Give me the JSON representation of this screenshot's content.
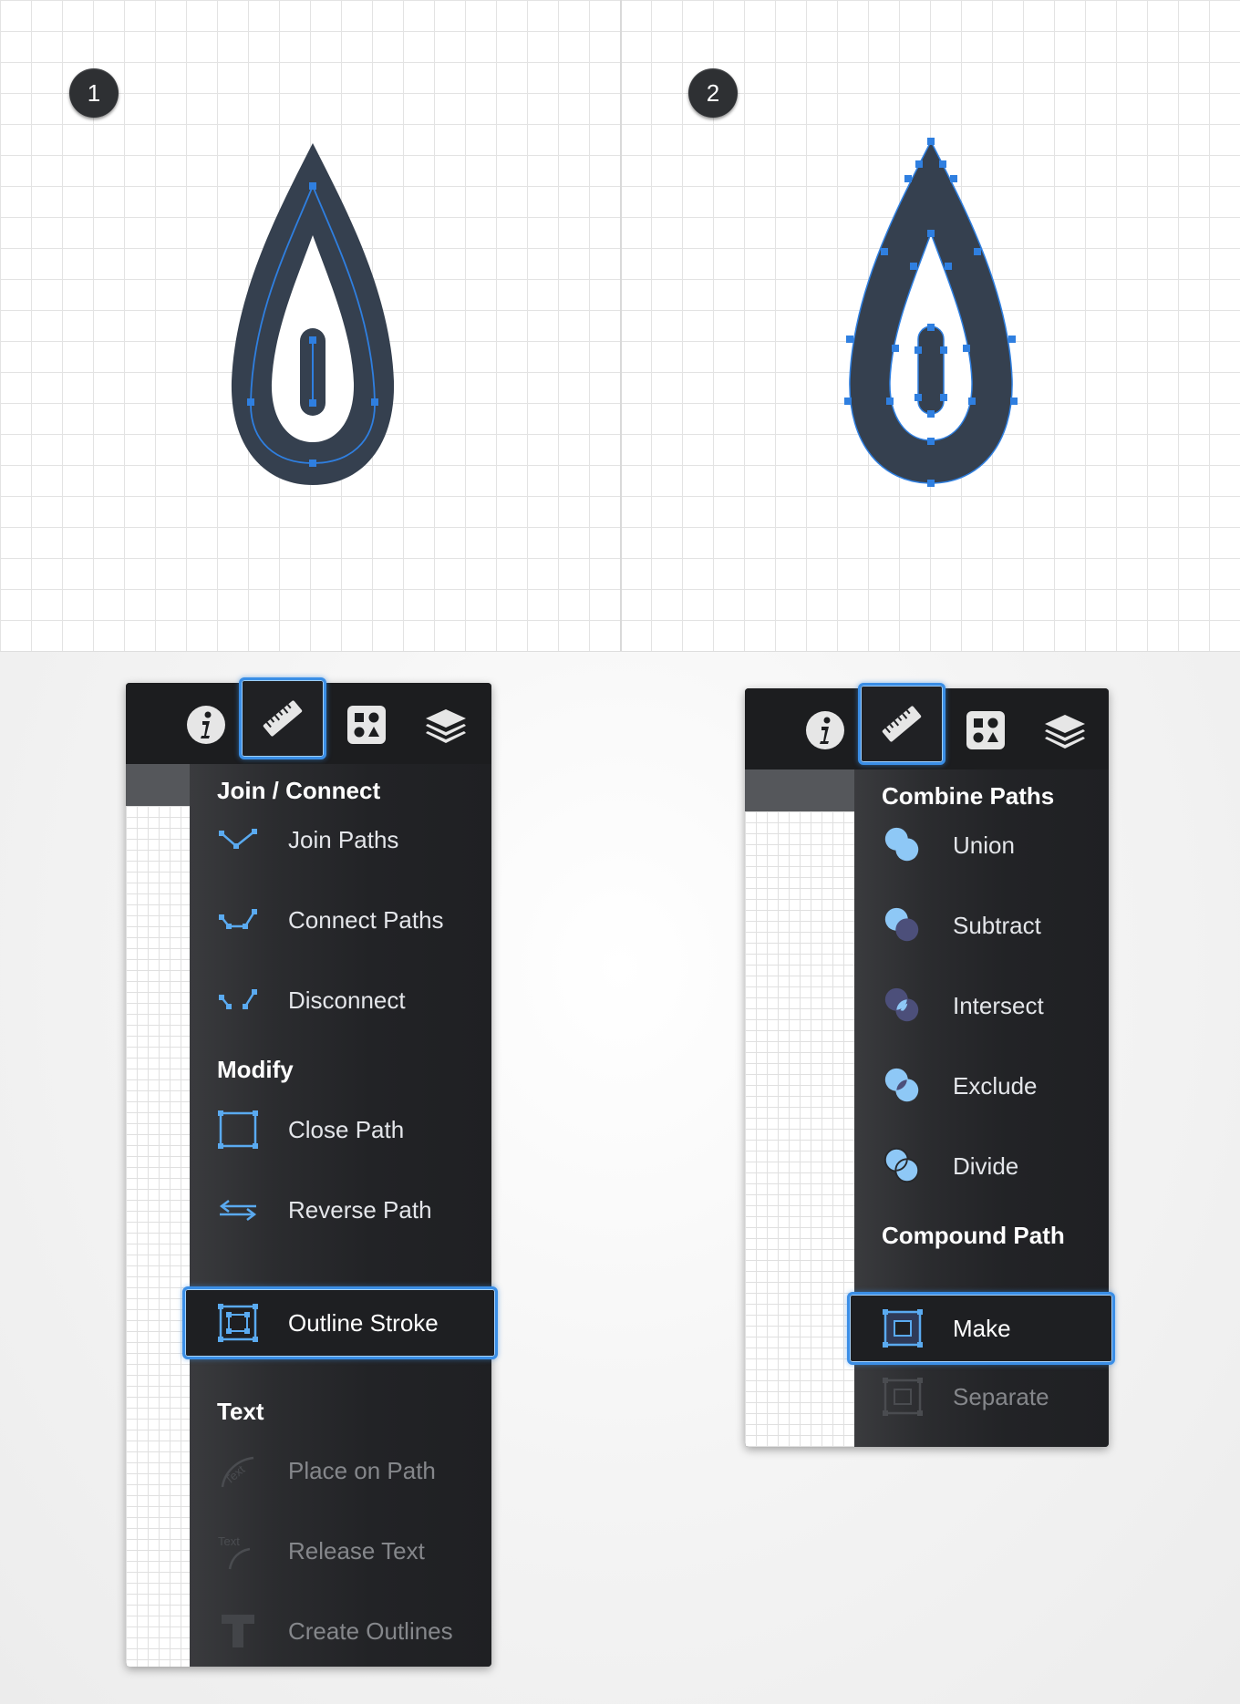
{
  "steps": {
    "step1": "1",
    "step2": "2"
  },
  "colors": {
    "accent": "#3a8ee6",
    "shape": "#35404f",
    "path": "#2f7fe0",
    "panel": "#1f2023"
  },
  "panel_left": {
    "header_icons": [
      "info-icon",
      "ruler-icon",
      "shapes-icon",
      "layers-icon"
    ],
    "selected_tab": "ruler-icon",
    "sections": [
      {
        "title": "Join / Connect",
        "items": [
          {
            "label": "Join Paths",
            "icon": "join-paths-icon",
            "enabled": true
          },
          {
            "label": "Connect Paths",
            "icon": "connect-paths-icon",
            "enabled": true
          },
          {
            "label": "Disconnect",
            "icon": "disconnect-icon",
            "enabled": true
          }
        ]
      },
      {
        "title": "Modify",
        "items": [
          {
            "label": "Close Path",
            "icon": "close-path-icon",
            "enabled": true
          },
          {
            "label": "Reverse Path",
            "icon": "reverse-path-icon",
            "enabled": true
          },
          {
            "label": "Outline Stroke",
            "icon": "outline-stroke-icon",
            "enabled": true,
            "highlighted": true
          }
        ]
      },
      {
        "title": "Text",
        "items": [
          {
            "label": "Place on Path",
            "icon": "place-on-path-icon",
            "enabled": false
          },
          {
            "label": "Release Text",
            "icon": "release-text-icon",
            "enabled": false
          },
          {
            "label": "Create Outlines",
            "icon": "create-outlines-icon",
            "enabled": false
          }
        ]
      }
    ],
    "icon_glyphs": {
      "place_on_path": "Text",
      "release_text": "Text"
    }
  },
  "panel_right": {
    "header_icons": [
      "info-icon",
      "ruler-icon",
      "shapes-icon",
      "layers-icon"
    ],
    "selected_tab": "ruler-icon",
    "sections": [
      {
        "title": "Combine Paths",
        "items": [
          {
            "label": "Union",
            "icon": "union-icon",
            "enabled": true
          },
          {
            "label": "Subtract",
            "icon": "subtract-icon",
            "enabled": true
          },
          {
            "label": "Intersect",
            "icon": "intersect-icon",
            "enabled": true
          },
          {
            "label": "Exclude",
            "icon": "exclude-icon",
            "enabled": true
          },
          {
            "label": "Divide",
            "icon": "divide-icon",
            "enabled": true
          }
        ]
      },
      {
        "title": "Compound Path",
        "items": [
          {
            "label": "Make",
            "icon": "make-compound-icon",
            "enabled": true,
            "highlighted": true
          },
          {
            "label": "Separate",
            "icon": "separate-compound-icon",
            "enabled": false
          }
        ]
      }
    ]
  }
}
